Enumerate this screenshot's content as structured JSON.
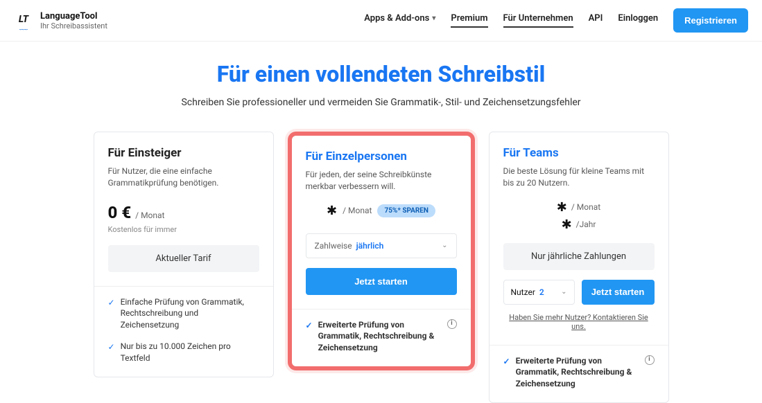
{
  "header": {
    "logo_title": "LanguageTool",
    "logo_sub": "Ihr Schreibassistent",
    "nav": {
      "apps": "Apps & Add-ons",
      "premium": "Premium",
      "business": "Für Unternehmen",
      "api": "API",
      "login": "Einloggen"
    },
    "register": "Registrieren"
  },
  "hero": {
    "title": "Für einen vollendeten Schreibstil",
    "subtitle": "Schreiben Sie professioneller und vermeiden Sie Grammatik-, Stil- und Zeichensetzungsfehler"
  },
  "plans": {
    "free": {
      "title": "Für Einsteiger",
      "desc": "Für Nutzer, die eine einfache Grammatikprüfung benötigen.",
      "price": "0 €",
      "per": "/ Monat",
      "note": "Kostenlos für immer",
      "button": "Aktueller Tarif",
      "feature1": "Einfache Prüfung von Grammatik, Rechtschreibung und Zeichensetzung",
      "feature2": "Nur bis zu 10.000 Zeichen pro Textfeld"
    },
    "individual": {
      "title": "Für Einzelpersonen",
      "desc": "Für jeden, der seine Schreibkünste merkbar verbessern will.",
      "per": "/ Monat",
      "save_badge": "75%* SPAREN",
      "billing_label": "Zahlweise",
      "billing_value": "jährlich",
      "button": "Jetzt starten",
      "feature1": "Erweiterte Prüfung von Grammatik, Rechtschreibung & Zeichensetzung"
    },
    "teams": {
      "title": "Für Teams",
      "desc": "Die beste Lösung für kleine Teams mit bis zu 20 Nutzern.",
      "per_month": "/ Monat",
      "per_year": "/Jahr",
      "billing_note": "Nur jährliche Zahlungen",
      "users_label": "Nutzer",
      "users_value": "2",
      "button": "Jetzt starten",
      "contact": "Haben Sie mehr Nutzer? Kontaktieren Sie uns.",
      "feature1": "Erweiterte Prüfung von Grammatik, Rechtschreibung & Zeichensetzung"
    }
  }
}
